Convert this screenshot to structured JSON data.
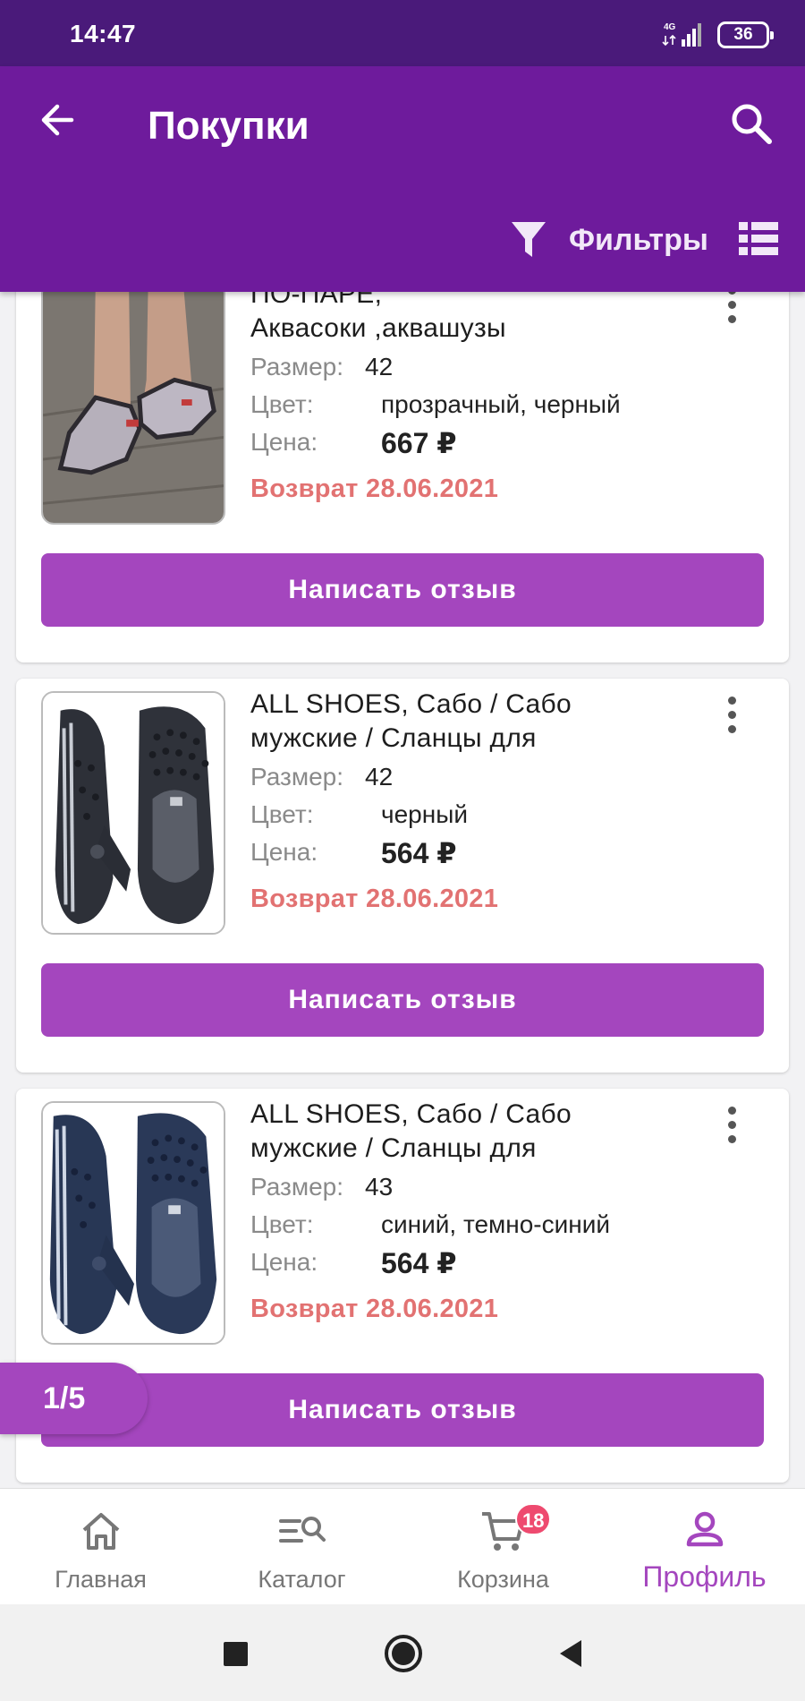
{
  "status_bar": {
    "time": "14:47",
    "network": "4G",
    "battery": "36"
  },
  "app_bar": {
    "title": "Покупки",
    "filter_label": "Фильтры"
  },
  "products": [
    {
      "title": "ПО-ПАРЕ,\nАквасоки ,аквашузы",
      "size_label": "Размер:",
      "size": "42",
      "color_label": "Цвет:",
      "color": "прозрачный, черный",
      "price_label": "Цена:",
      "price": "667 ₽",
      "return_text": "Возврат 28.06.2021",
      "review_button": "Написать отзыв",
      "image_icon": "aqua-socks-photo"
    },
    {
      "title": "ALL SHOES, Сабо / Сабо\nмужские / Сланцы для",
      "size_label": "Размер:",
      "size": "42",
      "color_label": "Цвет:",
      "color": "черный",
      "price_label": "Цена:",
      "price": "564 ₽",
      "return_text": "Возврат 28.06.2021",
      "review_button": "Написать отзыв",
      "image_icon": "black-clogs-photo"
    },
    {
      "title": "ALL SHOES, Сабо / Сабо\nмужские / Сланцы для",
      "size_label": "Размер:",
      "size": "43",
      "color_label": "Цвет:",
      "color": "синий, темно-синий",
      "price_label": "Цена:",
      "price": "564 ₽",
      "return_text": "Возврат 28.06.2021",
      "review_button": "Написать отзыв",
      "image_icon": "navy-clogs-photo"
    }
  ],
  "page_indicator": "1/5",
  "bottom_nav": [
    {
      "label": "Главная",
      "icon": "home-icon"
    },
    {
      "label": "Каталог",
      "icon": "catalog-search-icon"
    },
    {
      "label": "Корзина",
      "icon": "cart-icon",
      "badge": "18"
    },
    {
      "label": "Профиль",
      "icon": "profile-icon",
      "active": true
    }
  ],
  "colors": {
    "status_bar": "#4a1a7a",
    "app_bar": "#6e1b9c",
    "accent": "#a446be",
    "return_red": "#e27272",
    "badge": "#ee4a6f"
  }
}
